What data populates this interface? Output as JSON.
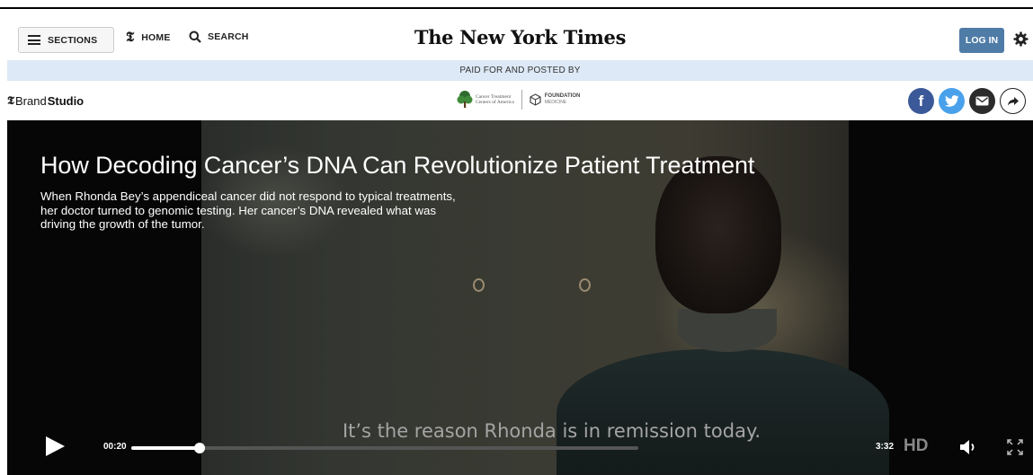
{
  "masthead": {
    "sections_label": "SECTIONS",
    "home_label": "HOME",
    "search_label": "SEARCH",
    "logo_text": "The New York Times",
    "login_label": "LOG IN"
  },
  "sponsor_bar": {
    "paid_label": "PAID FOR AND POSTED BY",
    "brand_prefix": "Brand",
    "brand_bold": "Studio",
    "ctca_line1": "Cancer Treatment",
    "ctca_line2": "Centers of America",
    "fm_line1": "FOUNDATION",
    "fm_line2": "MEDICINE"
  },
  "video": {
    "headline": "How Decoding Cancer’s DNA Can Revolutionize Patient Treatment",
    "dek": "When Rhonda Bey’s appendiceal cancer did not respond to typical treatments, her doctor turned to genomic testing. Her cancer’s DNA revealed what was driving the growth of the tumor.",
    "caption": "It’s the reason Rhonda is in remission today.",
    "current_time": "00:20",
    "duration": "3:32",
    "progress_fraction": 0.134,
    "hd_label": "HD"
  },
  "colors": {
    "login_blue": "#4f7ca7",
    "paid_bar": "#dde9f6",
    "facebook": "#3b5998",
    "twitter": "#4aa1eb"
  },
  "icons": [
    "hamburger-icon",
    "nyt-t-icon",
    "search-icon",
    "gear-icon",
    "facebook-icon",
    "twitter-icon",
    "email-icon",
    "share-forward-icon",
    "play-icon",
    "volume-icon",
    "fullscreen-icon"
  ]
}
